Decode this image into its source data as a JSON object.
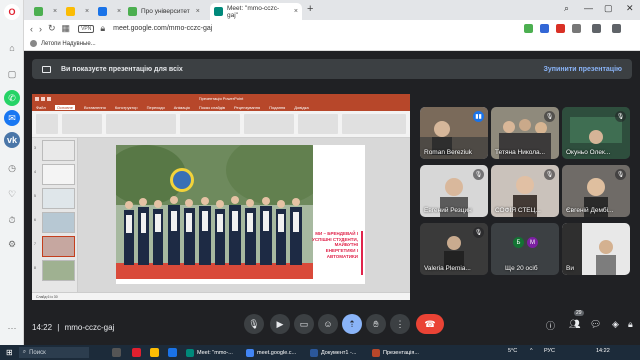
{
  "browser": {
    "tabs": [
      {
        "label": "",
        "color": "#4caf50"
      },
      {
        "label": "",
        "color": "#fbbc04"
      },
      {
        "label": "",
        "color": "#1a73e8"
      },
      {
        "label": "Про університет",
        "color": "#4caf50"
      },
      {
        "label": "Meet: \"mmo-cczc-gaj\"",
        "color": "#00897b"
      }
    ],
    "new_tab": "+",
    "address": {
      "vpn": "VPN",
      "url": "meet.google.com/mmo-cczc-gaj"
    },
    "bookmark": "Летопи Надувные..."
  },
  "meet": {
    "banner_text": "Ви показуєте презентацію для всіх",
    "stop_label": "Зупинити презентацію",
    "meeting_code": "mmo-cczc-gaj",
    "time": "14:22",
    "participant_count": "29",
    "participants": [
      {
        "name": "Roman Bereziuk"
      },
      {
        "name": "Тетяна Никола..."
      },
      {
        "name": "Окуньо Олек..."
      },
      {
        "name": "Евгений Резцин"
      },
      {
        "name": "СОФІЯ СТЕЦ..."
      },
      {
        "name": "Євгеній Дембі..."
      },
      {
        "name": "Valeria Plemia..."
      },
      {
        "name": "Ще 20 осіб",
        "avatars": [
          "Б",
          "М"
        ]
      },
      {
        "name": "Ви"
      }
    ]
  },
  "presentation": {
    "title_bar": "Презентація PowerPoint",
    "menu": [
      "Файл",
      "Основне",
      "Вставлення",
      "Конструктор",
      "Переходи",
      "Анімація",
      "Показ слайдів",
      "Рецензування",
      "Подання",
      "Довідка"
    ],
    "active_menu": "Основне",
    "slide_numbers": [
      "3",
      "4",
      "5",
      "6",
      "7",
      "8"
    ],
    "slide_text": "МИ – БРЕНДЕВАЙ І УСПІШНІ СТУДЕНТИ, МАЙБУТНІ ЕНЕРГЕТИКИ І АВТОМАТИКИ",
    "status": "Слайд 6 із 30"
  },
  "taskbar": {
    "search": "Поиск",
    "apps": [
      "Meet: \"mmo-...",
      "meet.google.c...",
      "Документ1 -...",
      "Презентація..."
    ],
    "weather": "5°C",
    "lang": "РУС",
    "clock": "14:22"
  },
  "colors": {
    "meet_bg": "#202124",
    "tile_bg": "#3c4043",
    "accent": "#8ab4f8",
    "end_call": "#ea4335",
    "ppt_red": "#b7472a"
  }
}
